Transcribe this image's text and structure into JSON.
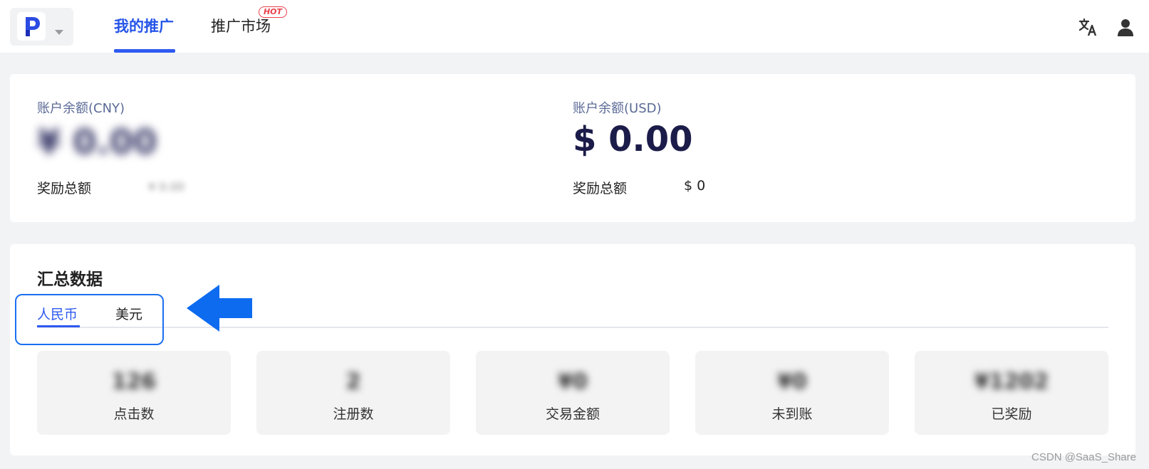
{
  "header": {
    "logo_letter": "P",
    "nav": [
      {
        "label": "我的推广",
        "active": true
      },
      {
        "label": "推广市场",
        "active": false,
        "badge": "HOT"
      }
    ],
    "icons": [
      "translate-icon",
      "user-icon"
    ]
  },
  "balance": {
    "cny": {
      "label": "账户余额(CNY)",
      "amount": "¥ 0.00",
      "reward_label": "奖励总额",
      "reward_value": "¥ 0.00"
    },
    "usd": {
      "label": "账户余额(USD)",
      "amount": "$ 0.00",
      "reward_label": "奖励总额",
      "reward_value": "$ 0"
    }
  },
  "summary": {
    "title": "汇总数据",
    "tabs": [
      {
        "label": "人民币",
        "active": true
      },
      {
        "label": "美元",
        "active": false
      }
    ],
    "stats": [
      {
        "value": "126",
        "label": "点击数"
      },
      {
        "value": "2",
        "label": "注册数"
      },
      {
        "value": "¥0",
        "label": "交易金额"
      },
      {
        "value": "¥0",
        "label": "未到账"
      },
      {
        "value": "¥1202",
        "label": "已奖励"
      }
    ]
  },
  "watermark": "CSDN @SaaS_Share",
  "colors": {
    "accent": "#2f5af0",
    "hot": "#e8404a",
    "highlight": "#1b6ff0",
    "amount": "#1c1c4a",
    "background": "#f2f3f5"
  }
}
